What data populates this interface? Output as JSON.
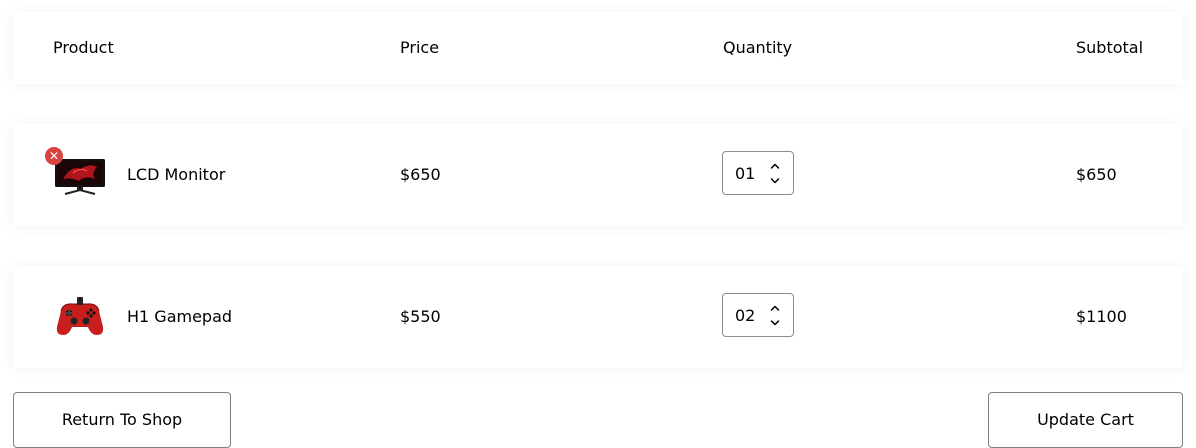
{
  "table": {
    "headers": {
      "product": "Product",
      "price": "Price",
      "quantity": "Quantity",
      "subtotal": "Subtotal"
    },
    "rows": [
      {
        "name": "LCD Monitor",
        "price": "$650",
        "quantity": "01",
        "subtotal": "$650",
        "image_icon": "monitor-image",
        "remove_icon": "remove-x-icon"
      },
      {
        "name": "H1 Gamepad",
        "price": "$550",
        "quantity": "02",
        "subtotal": "$1100",
        "image_icon": "gamepad-image"
      }
    ]
  },
  "actions": {
    "return_label": "Return To Shop",
    "update_label": "Update Cart"
  },
  "colors": {
    "remove_badge": "#db4444",
    "gamepad": "#c81e1e"
  }
}
